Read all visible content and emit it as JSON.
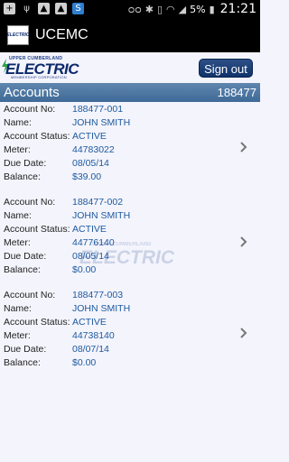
{
  "status_bar": {
    "battery": "5%",
    "time": "21:21",
    "left_icons": [
      "plus-icon",
      "usb-icon",
      "image-icon",
      "image-icon",
      "shazam-icon"
    ],
    "right_icons": [
      "voicemail-icon",
      "bluetooth-icon",
      "vibrate-icon",
      "wifi-icon",
      "signal-icon",
      "battery-icon"
    ]
  },
  "action_bar": {
    "app_icon_text": "ELECTRIC",
    "title": "UCEMC"
  },
  "header": {
    "logo_top": "UPPER CUMBERLAND",
    "logo_main": "ELECTRIC",
    "logo_sub": "MEMBERSHIP CORPORATION",
    "signout_label": "Sign out"
  },
  "accounts_bar": {
    "title": "Accounts",
    "number": "188477"
  },
  "labels": {
    "account_no": "Account No:",
    "name": "Name:",
    "status": "Account Status:",
    "meter": "Meter:",
    "due_date": "Due Date:",
    "balance": "Balance:"
  },
  "accounts": [
    {
      "account_no": "188477-001",
      "name": "JOHN SMITH",
      "status": "ACTIVE",
      "meter": "44783022",
      "due_date": "08/05/14",
      "balance": "$39.00"
    },
    {
      "account_no": "188477-002",
      "name": "JOHN SMITH",
      "status": "ACTIVE",
      "meter": "44776140",
      "due_date": "08/05/14",
      "balance": "$0.00"
    },
    {
      "account_no": "188477-003",
      "name": "JOHN SMITH",
      "status": "ACTIVE",
      "meter": "44738140",
      "due_date": "08/07/14",
      "balance": "$0.00"
    }
  ],
  "watermark": {
    "top": "UPPER CUMBERLAND",
    "main": "ELECTRIC"
  },
  "colors": {
    "brand_navy": "#0b2a6a",
    "value_blue": "#1d5aa0",
    "accounts_bar": "#4f78a2",
    "background": "#f4f4fc"
  }
}
